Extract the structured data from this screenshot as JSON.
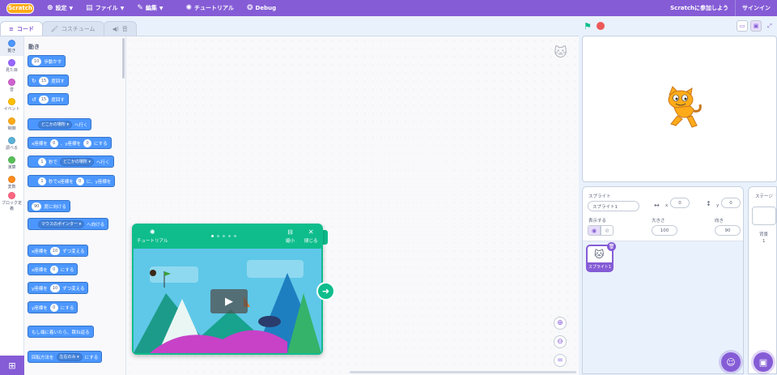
{
  "menu": {
    "logo": "Scratch",
    "items": [
      {
        "icon": "globe-icon",
        "label": "設定"
      },
      {
        "icon": "file-icon",
        "label": "ファイル"
      },
      {
        "icon": "pencil-icon",
        "label": "編集"
      },
      {
        "icon": "tutorial-icon",
        "label": "チュートリアル"
      },
      {
        "icon": "debug-icon",
        "label": "Debug"
      }
    ],
    "join": "Scratchに参加しよう",
    "signin": "サインイン"
  },
  "tabs": [
    {
      "label": "コード",
      "icon": "code-icon"
    },
    {
      "label": "コスチューム",
      "icon": "brush-icon"
    },
    {
      "label": "音",
      "icon": "speaker-icon"
    }
  ],
  "categories": [
    {
      "label": "動き",
      "color": "#4c97ff"
    },
    {
      "label": "見た目",
      "color": "#9966ff"
    },
    {
      "label": "音",
      "color": "#cf63cf"
    },
    {
      "label": "イベント",
      "color": "#ffbf00"
    },
    {
      "label": "制御",
      "color": "#ffab19"
    },
    {
      "label": "調べる",
      "color": "#5cb1d6"
    },
    {
      "label": "演算",
      "color": "#59c059"
    },
    {
      "label": "変数",
      "color": "#ff8c1a"
    },
    {
      "label": "ブロック定義",
      "color": "#ff6680"
    }
  ],
  "palette": {
    "title": "動き",
    "b1": {
      "val": "10",
      "text": "歩動かす"
    },
    "b2": {
      "val": "15",
      "text": "度回す"
    },
    "b3": {
      "val": "15",
      "text": "度回す"
    },
    "b4": {
      "dd": "どこかの場所",
      "text": "へ行く"
    },
    "b5": {
      "t1": "x座標を",
      "v1": "0",
      "t2": "、y座標を",
      "v2": "0",
      "t3": "にする"
    },
    "b6": {
      "v1": "1",
      "t1": "秒で",
      "dd": "どこかの場所",
      "t2": "へ行く"
    },
    "b7": {
      "v1": "1",
      "t1": "秒でx座標を",
      "v2": "0",
      "t2": "に、y座標を"
    },
    "b8": {
      "val": "90",
      "text": "度に向ける"
    },
    "b9": {
      "dd": "マウスのポインター",
      "text": "へ向ける"
    },
    "b10": {
      "t1": "x座標を",
      "val": "10",
      "t2": "ずつ変える"
    },
    "b11": {
      "t1": "x座標を",
      "val": "0",
      "t2": "にする"
    },
    "b12": {
      "t1": "y座標を",
      "val": "10",
      "t2": "ずつ変える"
    },
    "b13": {
      "t1": "y座標を",
      "val": "0",
      "t2": "にする"
    },
    "b14": {
      "text": "もし端に着いたら、跳ね返る"
    },
    "b15": {
      "t1": "回転方法を",
      "dd": "左右のみ",
      "t2": "にする"
    }
  },
  "tutorial": {
    "label": "チュートリアル",
    "shrink": "縮小",
    "close": "閉じる",
    "slides": 5,
    "active": 0
  },
  "sprite": {
    "label": "スプライト",
    "name": "スプライト1",
    "x_label": "x",
    "x": "0",
    "y_label": "y",
    "y": "0",
    "show_label": "表示する",
    "size_label": "大きさ",
    "size": "100",
    "dir_label": "向き",
    "dir": "90"
  },
  "stage_panel": {
    "label": "ステージ",
    "bg_label": "背景",
    "bg_count": "1"
  },
  "colors": {
    "accent": "#855cd6",
    "motion": "#4c97ff",
    "tutorial": "#0fbd8c"
  }
}
